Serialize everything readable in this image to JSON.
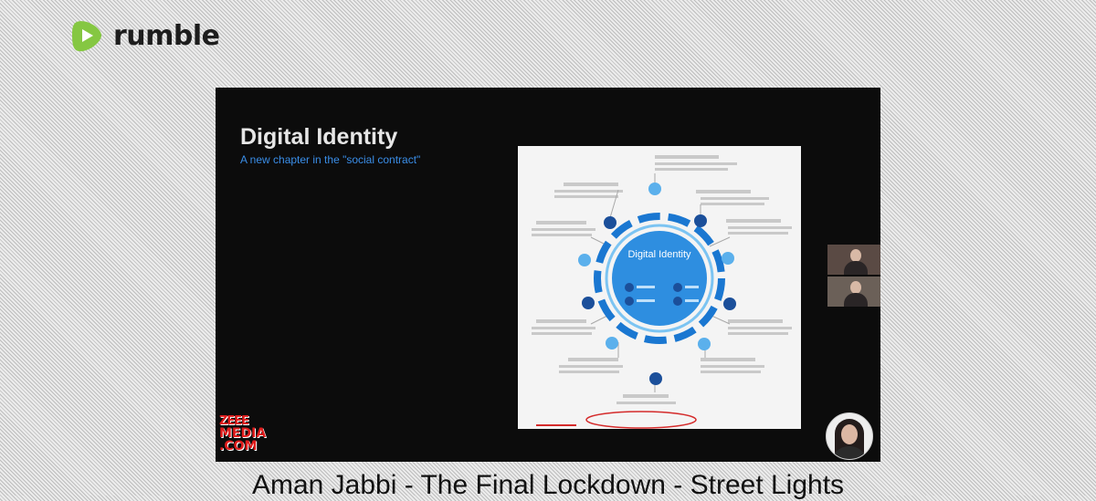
{
  "brand": {
    "name": "rumble",
    "accent": "#85c742"
  },
  "video": {
    "slide": {
      "title": "Digital Identity",
      "subtitle": "A new chapter in the \"social contract\"",
      "diagram_center_label": "Digital Identity"
    },
    "watermark": {
      "line1": "ZEEE",
      "line2": "MEDIA",
      "line3": ".COM"
    },
    "participants": [
      "participant-thumb-1",
      "participant-thumb-2",
      "presenter-avatar"
    ]
  },
  "caption": "Aman Jabbi - The Final Lockdown - Street Lights",
  "colors": {
    "slide_background": "#0c0c0c",
    "subtitle_blue": "#3a8ee8",
    "watermark_red": "#e01b1b"
  }
}
